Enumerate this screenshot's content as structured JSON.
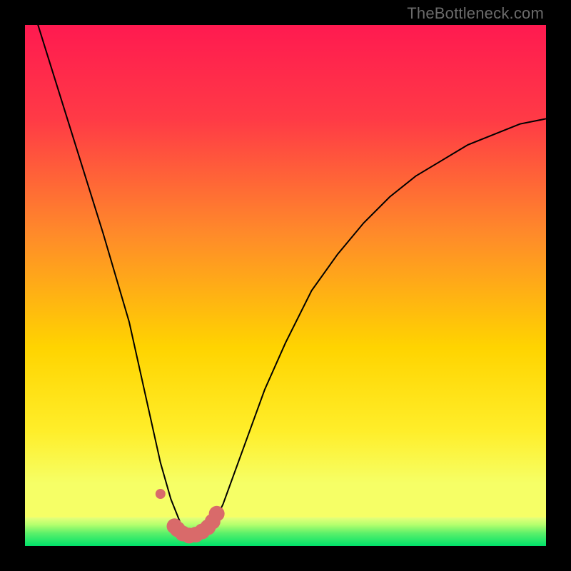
{
  "watermark": "TheBottleneck.com",
  "chart_data": {
    "type": "line",
    "title": "",
    "xlabel": "",
    "ylabel": "",
    "xlim": [
      0,
      100
    ],
    "ylim": [
      0,
      100
    ],
    "grid": false,
    "legend": false,
    "background_gradient": {
      "top_color": "#ff1a50",
      "mid_color": "#ffd400",
      "bottom_color": "#00e26a"
    },
    "green_band_top_fraction": 0.945,
    "annotations": [],
    "series": [
      {
        "name": "bottleneck-curve",
        "x": [
          0,
          5,
          10,
          15,
          20,
          24,
          26,
          28,
          30,
          32,
          34,
          36,
          38,
          42,
          46,
          50,
          55,
          60,
          65,
          70,
          75,
          80,
          85,
          90,
          95,
          100
        ],
        "y": [
          108,
          92,
          76,
          60,
          43,
          25,
          16,
          9,
          4,
          2,
          2,
          4,
          8,
          19,
          30,
          39,
          49,
          56,
          62,
          67,
          71,
          74,
          77,
          79,
          81,
          82
        ]
      },
      {
        "name": "marker-dots",
        "type": "scatter",
        "color": "#d96a6a",
        "x": [
          26.0,
          28.7,
          29.3,
          30.3,
          31.5,
          32.8,
          34.0,
          35.1,
          36.0,
          36.8
        ],
        "y": [
          10.0,
          3.8,
          3.2,
          2.4,
          2.0,
          2.2,
          2.8,
          3.6,
          4.7,
          6.2
        ],
        "r": [
          7,
          11,
          11,
          11,
          11,
          11,
          11,
          11,
          11,
          11
        ]
      }
    ]
  }
}
